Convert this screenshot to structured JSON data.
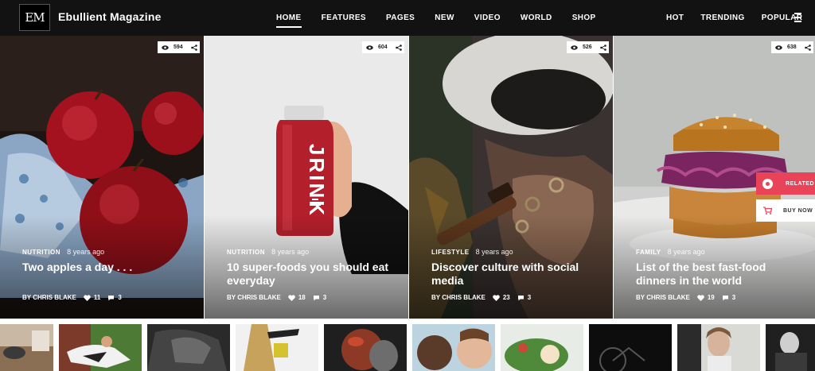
{
  "header": {
    "logo_text": "EM",
    "site_title": "Ebullient Magazine",
    "nav_main": [
      "HOME",
      "FEATURES",
      "PAGES",
      "NEW",
      "VIDEO",
      "WORLD",
      "SHOP"
    ],
    "nav_side": [
      "HOT",
      "TRENDING",
      "POPULAR"
    ]
  },
  "cards": [
    {
      "category": "NUTRITION",
      "time": "8 years ago",
      "title": "Two apples a day . . .",
      "author": "BY CHRIS BLAKE",
      "likes": "11",
      "comments": "3",
      "views": "594"
    },
    {
      "category": "NUTRITION",
      "time": "8 years ago",
      "title": "10 super-foods you should eat everyday",
      "author": "BY CHRIS BLAKE",
      "likes": "18",
      "comments": "3",
      "views": "604"
    },
    {
      "category": "LIFESTYLE",
      "time": "8 years ago",
      "title": "Discover culture with social media",
      "author": "BY CHRIS BLAKE",
      "likes": "23",
      "comments": "3",
      "views": "526"
    },
    {
      "category": "FAMILY",
      "time": "8 years ago",
      "title": "List of the best fast-food dinners in the world",
      "author": "BY CHRIS BLAKE",
      "likes": "19",
      "comments": "3",
      "views": "638"
    }
  ],
  "floating": {
    "related": "RELATED",
    "buy_now": "BUY NOW"
  },
  "product_label": "JRINK",
  "colors": {
    "accent": "#e94359",
    "header_bg": "#121212"
  }
}
